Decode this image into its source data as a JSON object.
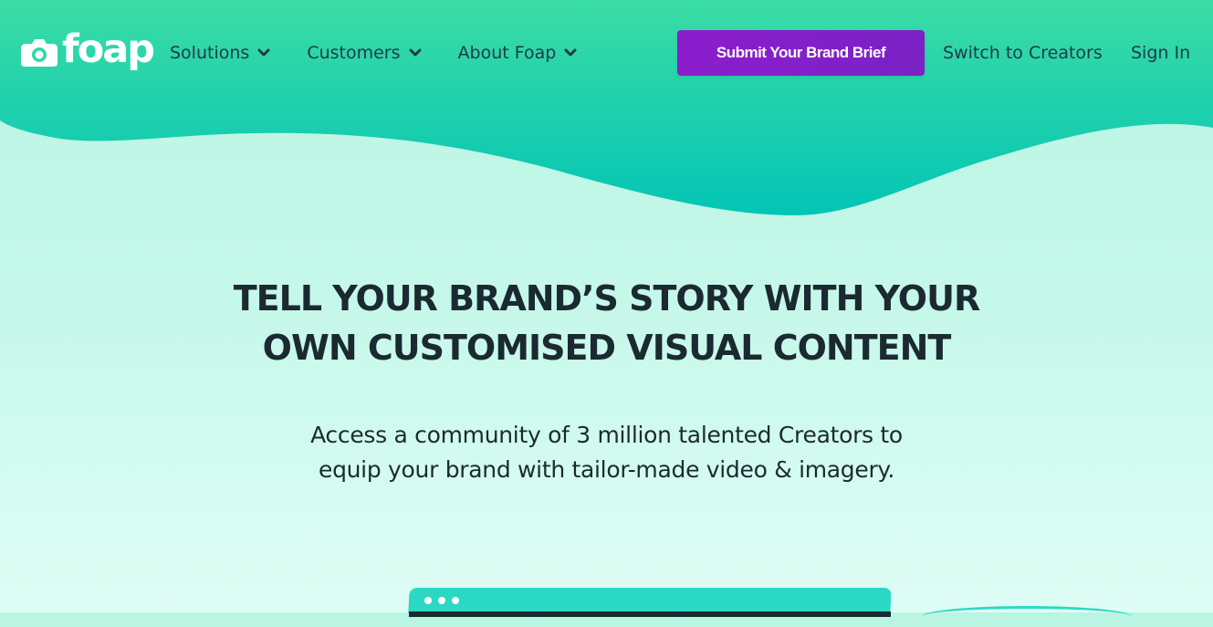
{
  "brand": {
    "logo_text": "foap",
    "logo_icon": "camera-icon"
  },
  "nav": {
    "items": [
      {
        "label": "Solutions",
        "icon": "chevron-down-icon"
      },
      {
        "label": "Customers",
        "icon": "chevron-down-icon"
      },
      {
        "label": "About Foap",
        "icon": "chevron-down-icon"
      }
    ],
    "cta_label": "Submit Your Brand Brief",
    "switch_label": "Switch to Creators",
    "signin_label": "Sign In"
  },
  "hero": {
    "title_line1": "TELL YOUR BRAND’S STORY WITH YOUR",
    "title_line2": "OWN CUSTOMISED VISUAL CONTENT",
    "subtitle_line1": "Access a community of 3 million talented Creators to",
    "subtitle_line2": "equip your brand with tailor-made video & imagery."
  },
  "colors": {
    "header_teal": "#2dd9a8",
    "header_teal_dark": "#03c6b4",
    "background_mint": "#c6f8ea",
    "cta_purple": "#8c1dcc",
    "text_dark": "#1b2a30",
    "nav_text": "#1f3a44"
  }
}
